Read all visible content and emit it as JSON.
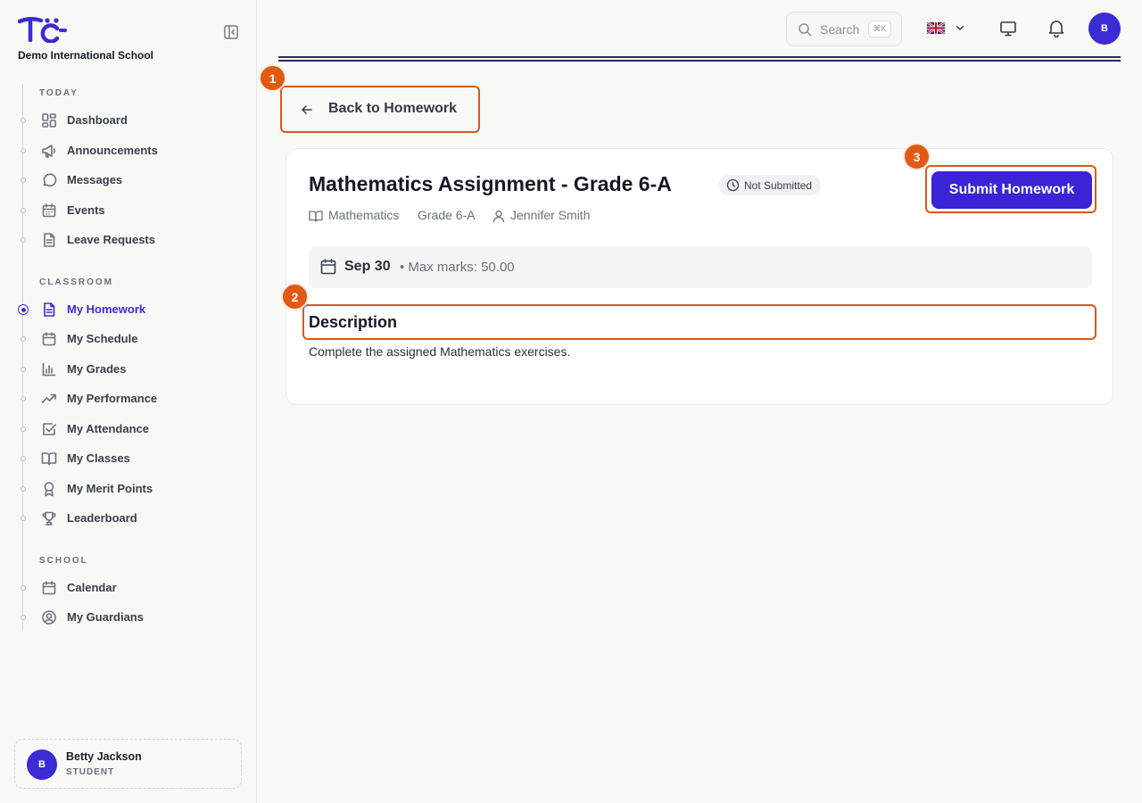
{
  "sidebar": {
    "school_name": "Demo International School",
    "sections": {
      "today": "TODAY",
      "classroom": "CLASSROOM",
      "school": "SCHOOL"
    },
    "items": {
      "dashboard": "Dashboard",
      "announcements": "Announcements",
      "messages": "Messages",
      "events": "Events",
      "leave_requests": "Leave Requests",
      "my_homework": "My Homework",
      "my_schedule": "My Schedule",
      "my_grades": "My Grades",
      "my_performance": "My Performance",
      "my_attendance": "My Attendance",
      "my_classes": "My Classes",
      "my_merit_points": "My Merit Points",
      "leaderboard": "Leaderboard",
      "calendar": "Calendar",
      "my_guardians": "My Guardians"
    },
    "active_item": "My Homework",
    "user": {
      "initial": "B",
      "name": "Betty Jackson",
      "role": "STUDENT"
    }
  },
  "header": {
    "search_placeholder": "Search",
    "search_shortcut": "⌘K",
    "avatar_initial": "B"
  },
  "markers": [
    "1",
    "2",
    "3"
  ],
  "back_button": "Back to Homework",
  "assignment": {
    "title": "Mathematics Assignment - Grade 6-A",
    "status": "Not Submitted",
    "subject": "Mathematics",
    "grade": "Grade 6-A",
    "teacher": "Jennifer Smith",
    "due_date": "Sep 30",
    "max_marks": "• Max marks: 50.00",
    "description_heading": "Description",
    "description": "Complete the assigned Mathematics exercises."
  },
  "submit_button": "Submit Homework",
  "colors": {
    "accent": "#3b24d6",
    "highlight": "#e05a14"
  }
}
